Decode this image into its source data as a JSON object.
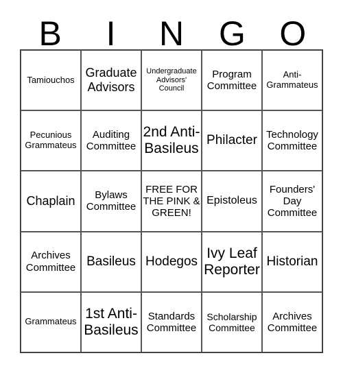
{
  "header": [
    "B",
    "I",
    "N",
    "G",
    "O"
  ],
  "cells": [
    "Tamiouchos",
    "Graduate Advisors",
    "Undergraduate Advisors' Council",
    "Program Committee",
    "Anti-Grammateus",
    "Pecunious Grammateus",
    "Auditing Committee",
    "2nd Anti-Basileus",
    "Philacter",
    "Technology Committee",
    "Chaplain",
    "Bylaws Committee",
    "FREE FOR THE PINK & GREEN!",
    "Epistoleus",
    "Founders' Day Committee",
    "Archives Committee",
    "Basileus",
    "Hodegos",
    "Ivy Leaf Reporter",
    "Historian",
    "Grammateus",
    "1st Anti-Basileus",
    "Standards Committee",
    "Scholarship Committee",
    "Archives Committee"
  ]
}
